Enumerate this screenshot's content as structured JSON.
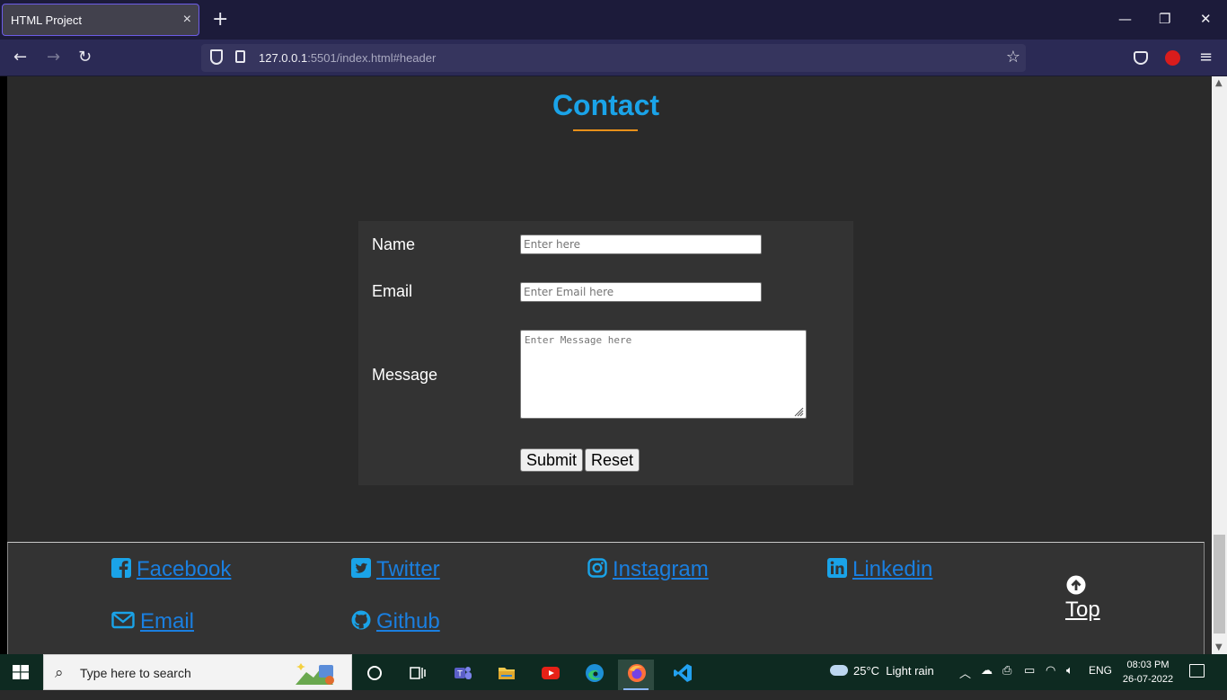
{
  "browser": {
    "tab_title": "HTML Project",
    "tab_close": "×",
    "new_tab": "+",
    "url_host": "127.0.0.1",
    "url_rest": ":5501/index.html#header",
    "back": "←",
    "forward": "→",
    "reload": "↻",
    "star": "☆",
    "menu": "≡",
    "minimize": "—",
    "restore": "❐",
    "close": "✕"
  },
  "page": {
    "contact_title": "Contact",
    "form": {
      "name_label": "Name",
      "name_placeholder": "Enter here",
      "email_label": "Email",
      "email_placeholder": "Enter Email here",
      "message_label": "Message",
      "message_placeholder": "Enter Message here",
      "submit_label": "Submit",
      "reset_label": "Reset"
    },
    "footer": {
      "links": [
        {
          "label": "Facebook",
          "icon": "facebook-icon"
        },
        {
          "label": "Twitter",
          "icon": "twitter-icon"
        },
        {
          "label": "Instagram",
          "icon": "instagram-icon"
        },
        {
          "label": "Linkedin",
          "icon": "linkedin-icon"
        },
        {
          "label": "Email",
          "icon": "envelope-icon"
        },
        {
          "label": "Github",
          "icon": "github-icon"
        }
      ],
      "top_label": "Top"
    },
    "link_color": "#1a7fe0",
    "accent_color": "#1aa3e8",
    "underline_color": "#e8901a"
  },
  "taskbar": {
    "search_placeholder": "Type here to search",
    "weather_temp": "25°C",
    "weather_desc": "Light rain",
    "language": "ENG",
    "time": "08:03 PM",
    "date": "26-07-2022"
  }
}
